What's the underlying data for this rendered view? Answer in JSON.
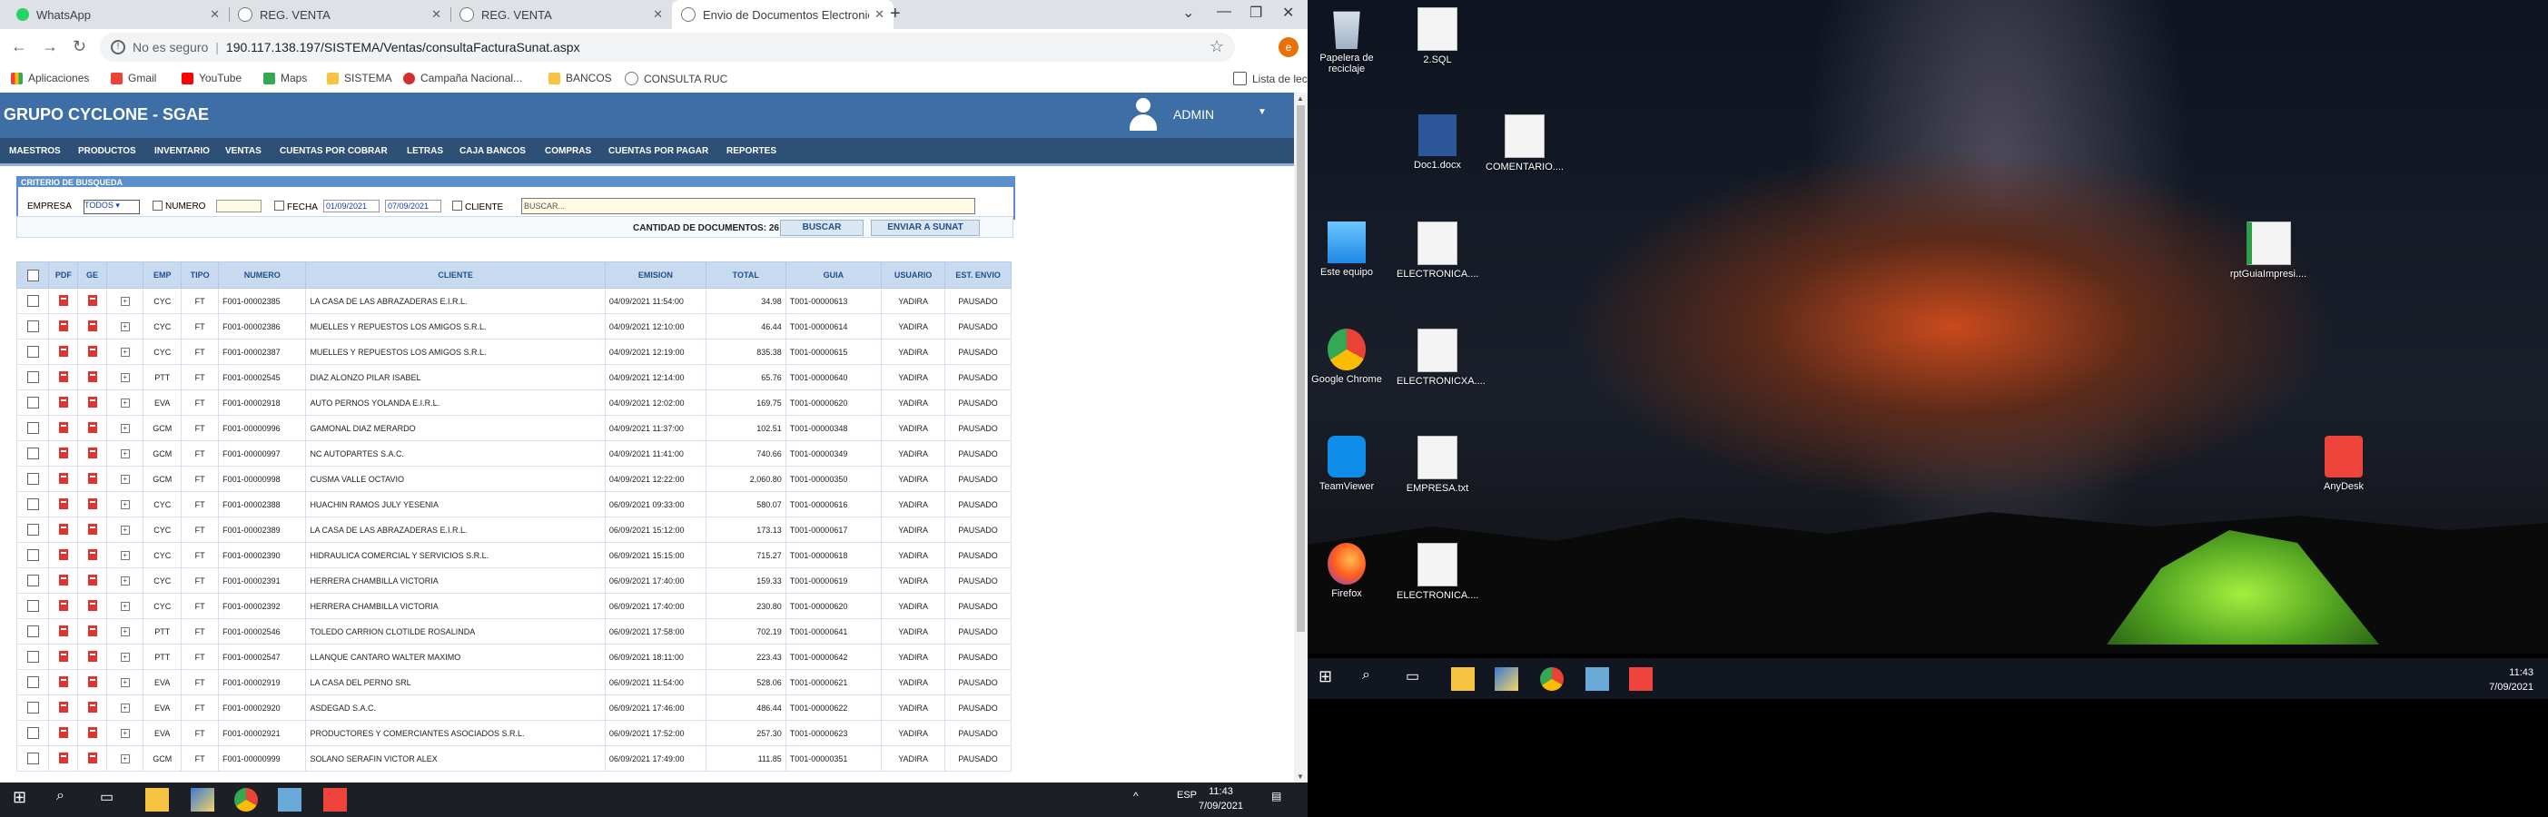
{
  "browser": {
    "tabs": [
      {
        "label": "WhatsApp"
      },
      {
        "label": "REG. VENTA"
      },
      {
        "label": "REG. VENTA"
      },
      {
        "label": "Envio de Documentos Electronic"
      }
    ],
    "security": "No es seguro",
    "url": "190.117.138.197/SISTEMA/Ventas/consultaFacturaSunat.aspx",
    "profile_initial": "e",
    "bookmarks": [
      "Aplicaciones",
      "Gmail",
      "YouTube",
      "Maps",
      "SISTEMA",
      "Campaña Nacional...",
      "BANCOS",
      "CONSULTA RUC"
    ],
    "reading_list": "Lista de lectura"
  },
  "app": {
    "title": "GRUPO CYCLONE - SGAE",
    "user": "ADMIN",
    "menu": [
      "MAESTROS",
      "PRODUCTOS",
      "INVENTARIO",
      "VENTAS",
      "CUENTAS POR COBRAR",
      "LETRAS",
      "CAJA BANCOS",
      "COMPRAS",
      "CUENTAS POR PAGAR",
      "REPORTES"
    ],
    "criteria": {
      "title": "CRITERIO DE BUSQUEDA",
      "empresa_label": "EMPRESA",
      "empresa_value": "TODOS",
      "numero_label": "NUMERO",
      "fecha_label": "FECHA",
      "fecha_desde": "01/09/2021",
      "fecha_hasta": "07/09/2021",
      "cliente_label": "CLIENTE",
      "cliente_placeholder": "BUSCAR..."
    },
    "count_text": "CANTIDAD DE DOCUMENTOS: 26",
    "buttons": {
      "buscar": "BUSCAR",
      "enviar": "ENVIAR A SUNAT"
    },
    "columns": [
      "PDF",
      "GE",
      "EMP",
      "TIPO",
      "NUMERO",
      "CLIENTE",
      "EMISION",
      "TOTAL",
      "GUIA",
      "USUARIO",
      "EST. ENVIO"
    ],
    "rows": [
      {
        "emp": "CYC",
        "tipo": "FT",
        "numero": "F001-00002385",
        "cliente": "LA CASA DE LAS ABRAZADERAS E.I.R.L.",
        "emision": "04/09/2021 11:54:00",
        "total": "34.98",
        "guia": "T001-00000613",
        "usuario": "YADIRA",
        "estado": "PAUSADO"
      },
      {
        "emp": "CYC",
        "tipo": "FT",
        "numero": "F001-00002386",
        "cliente": "MUELLES Y REPUESTOS LOS AMIGOS S.R.L.",
        "emision": "04/09/2021 12:10:00",
        "total": "46.44",
        "guia": "T001-00000614",
        "usuario": "YADIRA",
        "estado": "PAUSADO"
      },
      {
        "emp": "CYC",
        "tipo": "FT",
        "numero": "F001-00002387",
        "cliente": "MUELLES Y REPUESTOS LOS AMIGOS S.R.L.",
        "emision": "04/09/2021 12:19:00",
        "total": "835.38",
        "guia": "T001-00000615",
        "usuario": "YADIRA",
        "estado": "PAUSADO"
      },
      {
        "emp": "PTT",
        "tipo": "FT",
        "numero": "F001-00002545",
        "cliente": "DIAZ ALONZO PILAR ISABEL",
        "emision": "04/09/2021 12:14:00",
        "total": "65.76",
        "guia": "T001-00000640",
        "usuario": "YADIRA",
        "estado": "PAUSADO"
      },
      {
        "emp": "EVA",
        "tipo": "FT",
        "numero": "F001-00002918",
        "cliente": "AUTO PERNOS YOLANDA E.I.R.L.",
        "emision": "04/09/2021 12:02:00",
        "total": "169.75",
        "guia": "T001-00000620",
        "usuario": "YADIRA",
        "estado": "PAUSADO"
      },
      {
        "emp": "GCM",
        "tipo": "FT",
        "numero": "F001-00000996",
        "cliente": "GAMONAL DIAZ MERARDO",
        "emision": "04/09/2021 11:37:00",
        "total": "102.51",
        "guia": "T001-00000348",
        "usuario": "YADIRA",
        "estado": "PAUSADO"
      },
      {
        "emp": "GCM",
        "tipo": "FT",
        "numero": "F001-00000997",
        "cliente": "NC AUTOPARTES S.A.C.",
        "emision": "04/09/2021 11:41:00",
        "total": "740.66",
        "guia": "T001-00000349",
        "usuario": "YADIRA",
        "estado": "PAUSADO"
      },
      {
        "emp": "GCM",
        "tipo": "FT",
        "numero": "F001-00000998",
        "cliente": "CUSMA VALLE OCTAVIO",
        "emision": "04/09/2021 12:22:00",
        "total": "2,060.80",
        "guia": "T001-00000350",
        "usuario": "YADIRA",
        "estado": "PAUSADO"
      },
      {
        "emp": "CYC",
        "tipo": "FT",
        "numero": "F001-00002388",
        "cliente": "HUACHIN RAMOS JULY YESENIA",
        "emision": "06/09/2021 09:33:00",
        "total": "580.07",
        "guia": "T001-00000616",
        "usuario": "YADIRA",
        "estado": "PAUSADO"
      },
      {
        "emp": "CYC",
        "tipo": "FT",
        "numero": "F001-00002389",
        "cliente": "LA CASA DE LAS ABRAZADERAS E.I.R.L.",
        "emision": "06/09/2021 15:12:00",
        "total": "173.13",
        "guia": "T001-00000617",
        "usuario": "YADIRA",
        "estado": "PAUSADO"
      },
      {
        "emp": "CYC",
        "tipo": "FT",
        "numero": "F001-00002390",
        "cliente": "HIDRAULICA COMERCIAL Y SERVICIOS S.R.L.",
        "emision": "06/09/2021 15:15:00",
        "total": "715.27",
        "guia": "T001-00000618",
        "usuario": "YADIRA",
        "estado": "PAUSADO"
      },
      {
        "emp": "CYC",
        "tipo": "FT",
        "numero": "F001-00002391",
        "cliente": "HERRERA CHAMBILLA VICTORIA",
        "emision": "06/09/2021 17:40:00",
        "total": "159.33",
        "guia": "T001-00000619",
        "usuario": "YADIRA",
        "estado": "PAUSADO"
      },
      {
        "emp": "CYC",
        "tipo": "FT",
        "numero": "F001-00002392",
        "cliente": "HERRERA CHAMBILLA VICTORIA",
        "emision": "06/09/2021 17:40:00",
        "total": "230.80",
        "guia": "T001-00000620",
        "usuario": "YADIRA",
        "estado": "PAUSADO"
      },
      {
        "emp": "PTT",
        "tipo": "FT",
        "numero": "F001-00002546",
        "cliente": "TOLEDO CARRION CLOTILDE ROSALINDA",
        "emision": "06/09/2021 17:58:00",
        "total": "702.19",
        "guia": "T001-00000641",
        "usuario": "YADIRA",
        "estado": "PAUSADO"
      },
      {
        "emp": "PTT",
        "tipo": "FT",
        "numero": "F001-00002547",
        "cliente": "LLANQUE CANTARO WALTER MAXIMO",
        "emision": "06/09/2021 18:11:00",
        "total": "223.43",
        "guia": "T001-00000642",
        "usuario": "YADIRA",
        "estado": "PAUSADO"
      },
      {
        "emp": "EVA",
        "tipo": "FT",
        "numero": "F001-00002919",
        "cliente": "LA CASA DEL PERNO SRL",
        "emision": "06/09/2021 11:54:00",
        "total": "528.06",
        "guia": "T001-00000621",
        "usuario": "YADIRA",
        "estado": "PAUSADO"
      },
      {
        "emp": "EVA",
        "tipo": "FT",
        "numero": "F001-00002920",
        "cliente": "ASDEGAD S.A.C.",
        "emision": "06/09/2021 17:46:00",
        "total": "486.44",
        "guia": "T001-00000622",
        "usuario": "YADIRA",
        "estado": "PAUSADO"
      },
      {
        "emp": "EVA",
        "tipo": "FT",
        "numero": "F001-00002921",
        "cliente": "PRODUCTORES Y COMERCIANTES ASOCIADOS S.R.L.",
        "emision": "06/09/2021 17:52:00",
        "total": "257.30",
        "guia": "T001-00000623",
        "usuario": "YADIRA",
        "estado": "PAUSADO"
      },
      {
        "emp": "GCM",
        "tipo": "FT",
        "numero": "F001-00000999",
        "cliente": "SOLANO SERAFIN VICTOR ALEX",
        "emision": "06/09/2021 17:49:00",
        "total": "111.85",
        "guia": "T001-00000351",
        "usuario": "YADIRA",
        "estado": "PAUSADO"
      }
    ]
  },
  "taskbar_left": {
    "lang": "ESP",
    "time": "11:43",
    "date": "7/09/2021"
  },
  "desktop": {
    "icons": [
      {
        "label": "Papelera de reciclaje",
        "icon": "recycle-bin-icon"
      },
      {
        "label": "2.SQL",
        "icon": "sql-file-icon"
      },
      {
        "label": "Doc1.docx",
        "icon": "word-doc-icon"
      },
      {
        "label": "COMENTARIO....",
        "icon": "text-file-icon"
      },
      {
        "label": "Este equipo",
        "icon": "computer-icon"
      },
      {
        "label": "ELECTRONICA....",
        "icon": "text-file-icon"
      },
      {
        "label": "rptGuiaImpresi....",
        "icon": "report-file-icon"
      },
      {
        "label": "Google Chrome",
        "icon": "chrome-icon"
      },
      {
        "label": "ELECTRONICXA....",
        "icon": "text-file-icon"
      },
      {
        "label": "TeamViewer",
        "icon": "teamviewer-icon"
      },
      {
        "label": "EMPRESA.txt",
        "icon": "text-file-icon"
      },
      {
        "label": "AnyDesk",
        "icon": "anydesk-icon"
      },
      {
        "label": "Firefox",
        "icon": "firefox-icon"
      },
      {
        "label": "ELECTRONICA....",
        "icon": "text-file-icon"
      }
    ],
    "time": "11:43",
    "date": "7/09/2021"
  },
  "colors": {
    "app_header": "#3d6ea6",
    "menu_bar": "#2e4f76",
    "grid_header": "#c7daf0",
    "pdf_red": "#dd3333"
  }
}
